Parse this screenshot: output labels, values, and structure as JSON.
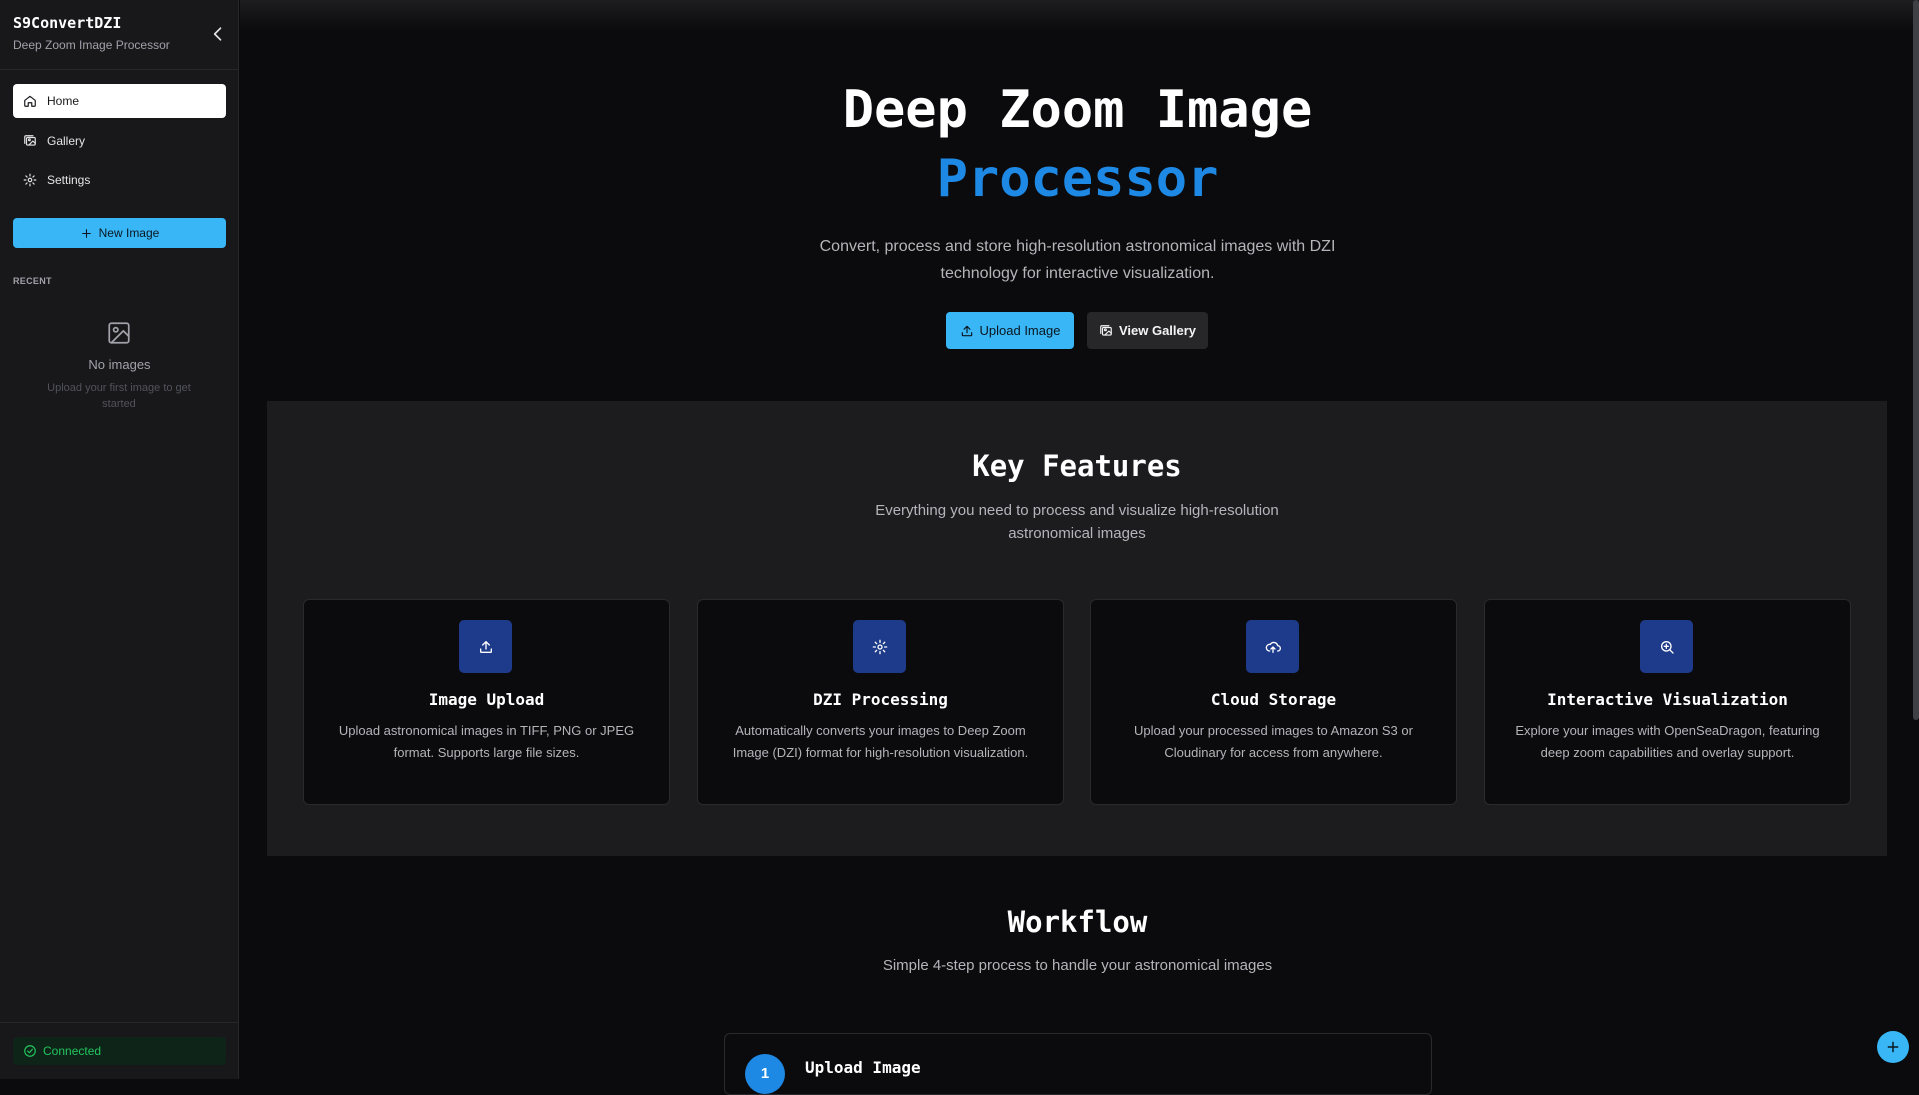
{
  "sidebar": {
    "brand": "S9ConvertDZI",
    "subtitle": "Deep Zoom Image Processor",
    "nav": [
      {
        "label": "Home",
        "icon": "home-icon",
        "active": true
      },
      {
        "label": "Gallery",
        "icon": "gallery-icon",
        "active": false
      },
      {
        "label": "Settings",
        "icon": "gear-icon",
        "active": false
      }
    ],
    "new_button": "New Image",
    "recent_label": "RECENT",
    "empty_title": "No images",
    "empty_subtitle": "Upload your first image to get started",
    "status": "Connected"
  },
  "hero": {
    "title_line1": "Deep Zoom Image",
    "title_line2": "Processor",
    "description": "Convert, process and store high-resolution astronomical images with DZI technology for interactive visualization.",
    "upload_button": "Upload Image",
    "gallery_button": "View Gallery"
  },
  "features": {
    "title": "Key Features",
    "description": "Everything you need to process and visualize high-resolution astronomical images",
    "cards": [
      {
        "title": "Image Upload",
        "icon": "upload-icon",
        "description": "Upload astronomical images in TIFF, PNG or JPEG format. Supports large file sizes."
      },
      {
        "title": "DZI Processing",
        "icon": "gear-icon",
        "description": "Automatically converts your images to Deep Zoom Image (DZI) format for high-resolution visualization."
      },
      {
        "title": "Cloud Storage",
        "icon": "cloud-upload-icon",
        "description": "Upload your processed images to Amazon S3 or Cloudinary for access from anywhere."
      },
      {
        "title": "Interactive Visualization",
        "icon": "zoom-in-icon",
        "description": "Explore your images with OpenSeaDragon, featuring deep zoom capabilities and overlay support."
      }
    ]
  },
  "workflow": {
    "title": "Workflow",
    "description": "Simple 4-step process to handle your astronomical images",
    "steps": [
      {
        "number": "1",
        "title": "Upload Image"
      }
    ]
  },
  "colors": {
    "accent": "#38b6f5",
    "brand_blue": "#1e88e5",
    "icon_bg": "#1e3a8a",
    "status_green": "#22c55e"
  }
}
